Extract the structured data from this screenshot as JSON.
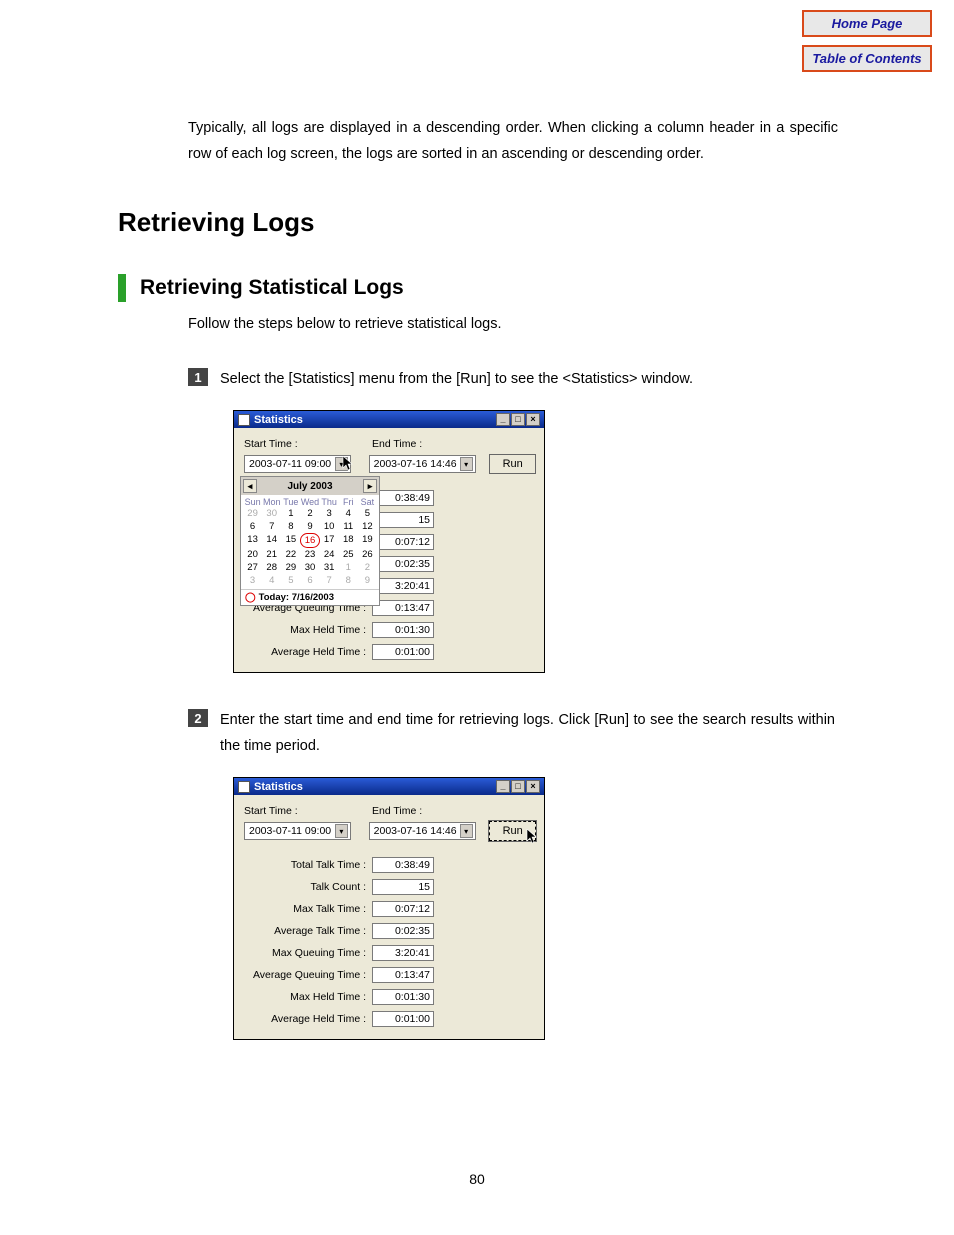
{
  "nav": {
    "home": "Home Page",
    "toc": "Table of Contents"
  },
  "intro": "Typically, all logs are displayed in a descending order. When clicking a column header in a specific row of each log screen, the logs are sorted in an ascending or descending order.",
  "h1": "Retrieving Logs",
  "h2": "Retrieving Statistical Logs",
  "follow": "Follow the steps below to retrieve statistical logs.",
  "steps": {
    "s1": {
      "num": "1",
      "text": "Select the [Statistics] menu from the [Run] to see the <Statistics> window."
    },
    "s2": {
      "num": "2",
      "text": "Enter the start time and end time for retrieving logs. Click [Run] to see the search results within the time period."
    }
  },
  "win": {
    "title": "Statistics",
    "start_label": "Start Time :",
    "end_label": "End Time :",
    "start_val": "2003-07-11 09:00",
    "end_val": "2003-07-16 14:46",
    "run": "Run",
    "rows": {
      "total_talk": {
        "label": "Total Talk Time :",
        "val": "0:38:49"
      },
      "talk_count": {
        "label": "Talk Count :",
        "val": "15"
      },
      "max_talk": {
        "label": "Max Talk Time :",
        "val": "0:07:12"
      },
      "avg_talk": {
        "label": "Average Talk Time :",
        "val": "0:02:35"
      },
      "max_queue": {
        "label": "Max Queuing Time :",
        "val": "3:20:41"
      },
      "avg_queue": {
        "label": "Average Queuing Time :",
        "val": "0:13:47"
      },
      "max_held": {
        "label": "Max Held Time :",
        "val": "0:01:30"
      },
      "avg_held": {
        "label": "Average Held Time :",
        "val": "0:01:00"
      }
    }
  },
  "cal": {
    "title": "July 2003",
    "days": [
      "Sun",
      "Mon",
      "Tue",
      "Wed",
      "Thu",
      "Fri",
      "Sat"
    ],
    "grid": [
      [
        "29",
        "30",
        "1",
        "2",
        "3",
        "4",
        "5"
      ],
      [
        "6",
        "7",
        "8",
        "9",
        "10",
        "11",
        "12"
      ],
      [
        "13",
        "14",
        "15",
        "16",
        "17",
        "18",
        "19"
      ],
      [
        "20",
        "21",
        "22",
        "23",
        "24",
        "25",
        "26"
      ],
      [
        "27",
        "28",
        "29",
        "30",
        "31",
        "1",
        "2"
      ],
      [
        "3",
        "4",
        "5",
        "6",
        "7",
        "8",
        "9"
      ]
    ],
    "dim_first": 2,
    "dim_last_start": [
      4,
      5
    ],
    "today": "Today: 7/16/2003",
    "selected": "16"
  },
  "page_num": "80"
}
